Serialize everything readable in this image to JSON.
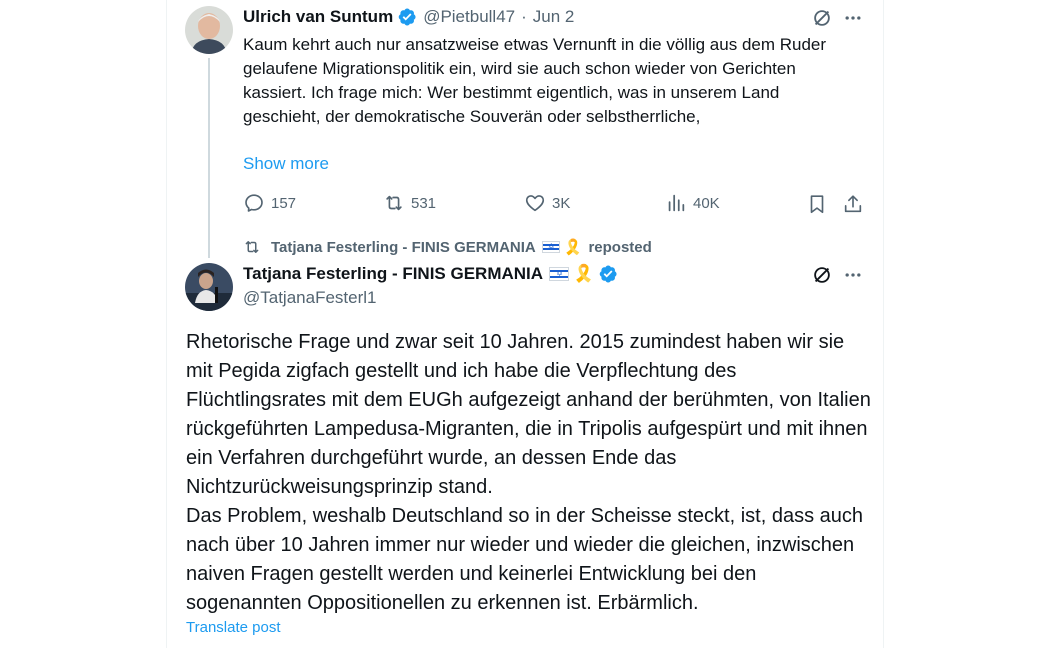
{
  "tweet1": {
    "author_name": "Ulrich van Suntum",
    "handle": "@Pietbull47",
    "separator": "·",
    "date": "Jun 2",
    "text": "Kaum kehrt auch nur ansatzweise etwas Vernunft in die völlig aus dem Ruder gelaufene Migrationspolitik ein, wird sie auch schon wieder von Gerichten kassiert. Ich frage mich: Wer bestimmt eigentlich, was in unserem Land geschieht, der demokratische Souverän oder selbstherrliche,",
    "show_more": "Show more",
    "replies": "157",
    "reposts": "531",
    "likes": "3K",
    "views": "40K",
    "icons": [
      "grok-icon",
      "more-icon",
      "reply-icon",
      "repost-icon",
      "like-icon",
      "views-icon",
      "bookmark-icon",
      "share-icon"
    ]
  },
  "repost_banner": {
    "name": "Tatjana Festerling - FINIS GERMANIA",
    "emoji_ribbon": "🎗️",
    "label": "reposted"
  },
  "tweet2": {
    "author_name": "Tatjana Festerling - FINIS GERMANIA",
    "emoji_ribbon": "🎗️",
    "handle": "@TatjanaFesterl1",
    "text": "Rhetorische Frage und zwar seit 10 Jahren. 2015 zumindest haben wir sie mit Pegida zigfach gestellt und ich habe die Verpflechtung des Flüchtlingsrates mit dem EUGh aufgezeigt anhand der berühmten, von Italien rückgeführten Lampedusa-Migranten, die in Tripolis aufgespürt und mit ihnen ein Verfahren durchgeführt wurde, an dessen Ende das Nichtzurückweisungsprinzip stand.\nDas Problem, weshalb Deutschland so in der Scheisse steckt, ist, dass auch nach über 10 Jahren immer nur wieder und wieder die gleichen, inzwischen naiven Fragen gestellt werden und keinerlei Entwicklung bei den sogenannten Oppositionellen zu erkennen ist. Erbärmlich.",
    "translate": "Translate post"
  },
  "colors": {
    "accent": "#1d9bf0",
    "secondary_text": "#536471",
    "ribbon": "#f4b400"
  }
}
